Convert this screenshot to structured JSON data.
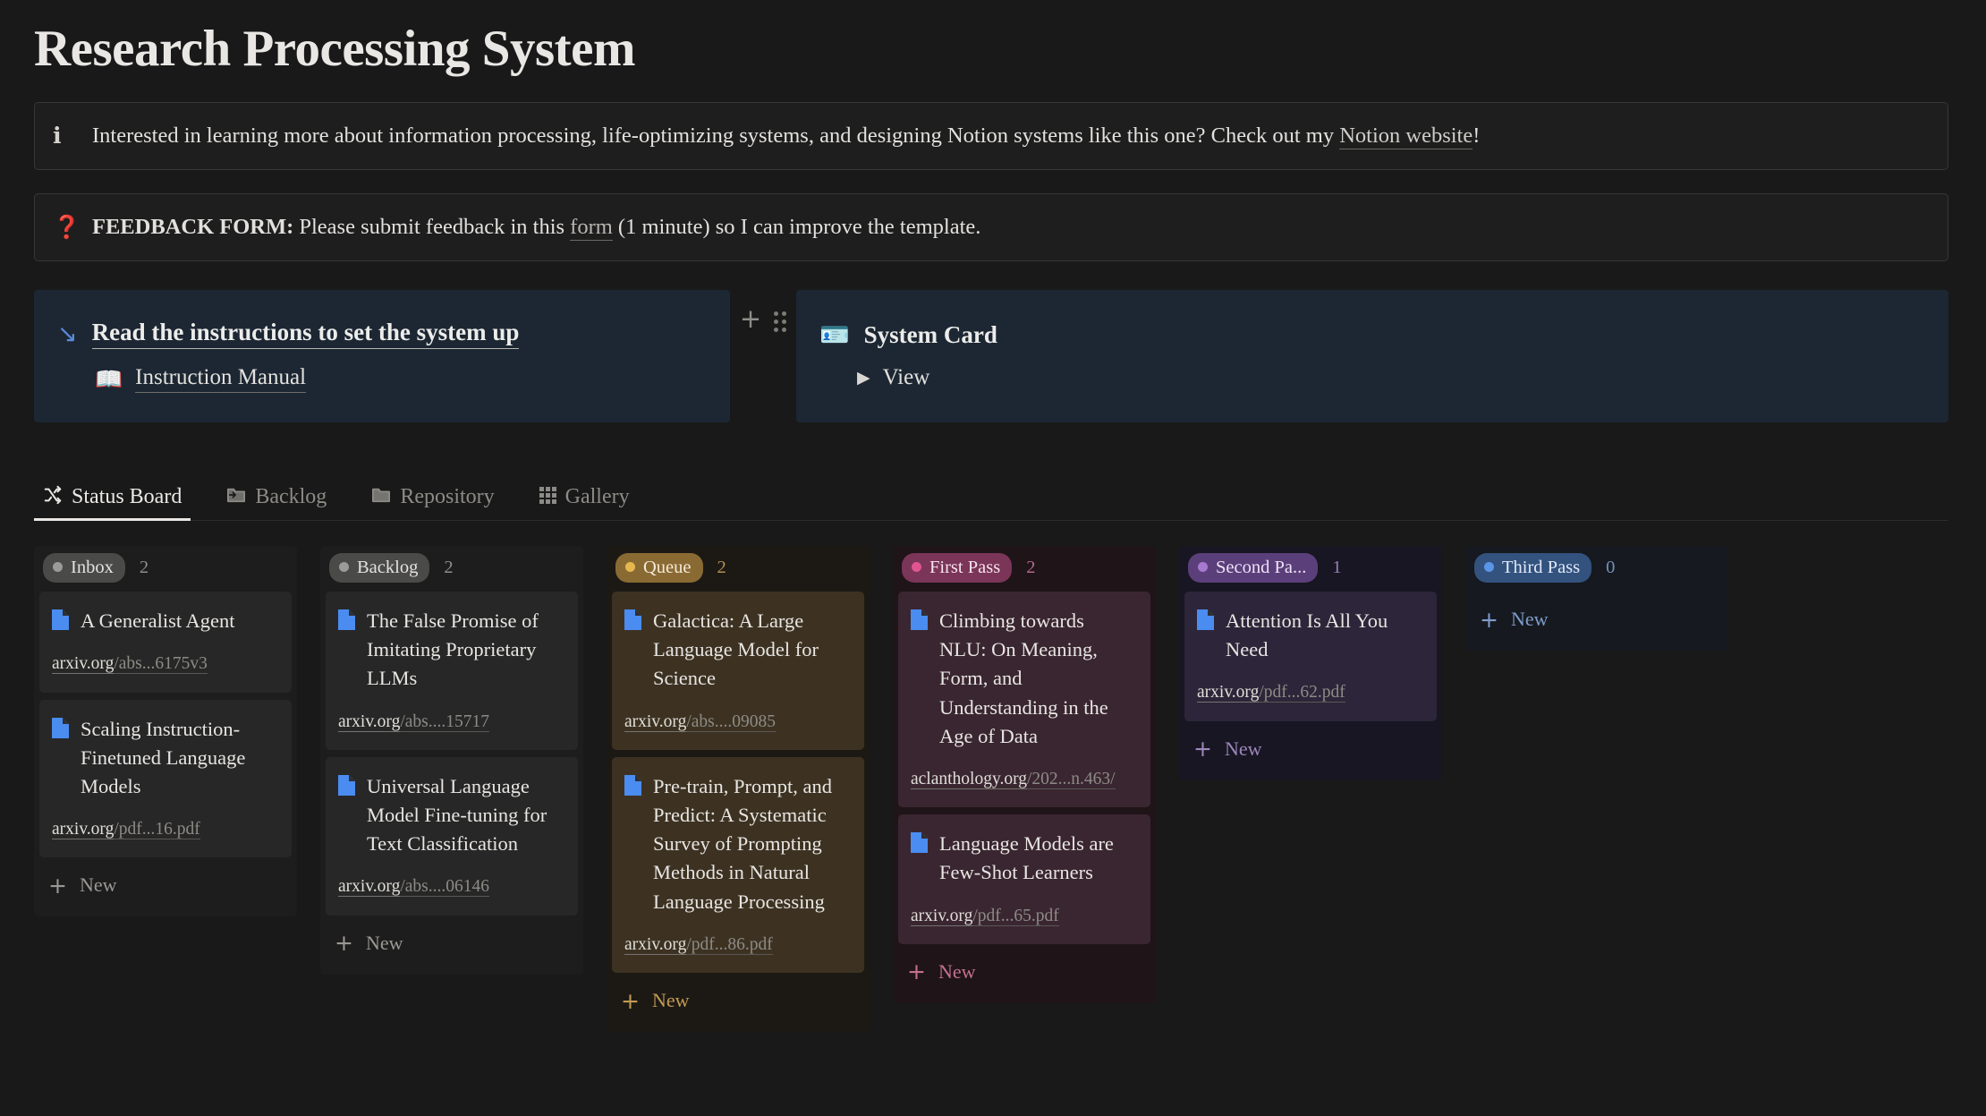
{
  "page": {
    "title": "Research Processing System"
  },
  "callouts": [
    {
      "icon": "info-icon",
      "glyph": "ℹ",
      "segments": [
        {
          "type": "text",
          "value": "Interested in learning more about information processing, life-optimizing systems, and designing Notion systems like this one? Check out my "
        },
        {
          "type": "link",
          "value": "Notion website"
        },
        {
          "type": "text",
          "value": "!"
        }
      ]
    },
    {
      "icon": "question-icon",
      "glyph": "❓",
      "segments": [
        {
          "type": "bold",
          "value": "FEEDBACK FORM:"
        },
        {
          "type": "text",
          "value": " Please submit feedback in this "
        },
        {
          "type": "link",
          "value": "form"
        },
        {
          "type": "text",
          "value": " (1 minute) so I can improve the template."
        }
      ]
    }
  ],
  "feature_cards": {
    "gutter": {
      "add_label": "+",
      "drag_label": "drag-handle"
    },
    "left": {
      "icon": "arrow-down-right-icon",
      "glyph": "↘",
      "title": "Read the instructions to set the system up",
      "sub_icon": "open-book-icon",
      "sub_glyph": "📖",
      "sub_label": "Instruction Manual"
    },
    "right": {
      "icon": "id-badge-icon",
      "glyph": "🪪",
      "title": "System Card",
      "toggle_glyph": "▶",
      "toggle_label": "View"
    }
  },
  "tabs": [
    {
      "label": "Status Board",
      "icon": "shuffle-icon",
      "glyph": "🔀",
      "active": true
    },
    {
      "label": "Backlog",
      "icon": "folder-in-icon",
      "glyph": "📂",
      "active": false
    },
    {
      "label": "Repository",
      "icon": "folder-icon",
      "glyph": "📁",
      "active": false
    },
    {
      "label": "Gallery",
      "icon": "grid-icon",
      "glyph": "▒",
      "active": false
    }
  ],
  "board": {
    "new_label": "New",
    "columns": [
      {
        "name": "Inbox",
        "count": "2",
        "colors": {
          "pill_bg": "#4a4a48",
          "pill_text": "#e4e2df",
          "dot": "#9b9b97",
          "col_bg": "#1d1d1d",
          "card_bg": "#272727",
          "count_text": "#8f8d89",
          "new_text": "#9a9894"
        },
        "cards": [
          {
            "title": "A Generalist Agent",
            "host": "arxiv.org",
            "path": "/abs...6175v3"
          },
          {
            "title": "Scaling Instruction-Finetuned Language Models",
            "host": "arxiv.org",
            "path": "/pdf...16.pdf"
          }
        ]
      },
      {
        "name": "Backlog",
        "count": "2",
        "colors": {
          "pill_bg": "#4a4a48",
          "pill_text": "#e4e2df",
          "dot": "#9b9b97",
          "col_bg": "#1d1d1d",
          "card_bg": "#272727",
          "count_text": "#8f8d89",
          "new_text": "#9a9894"
        },
        "cards": [
          {
            "title": "The False Promise of Imitating Proprietary LLMs",
            "host": "arxiv.org",
            "path": "/abs....15717"
          },
          {
            "title": "Universal Language Model Fine-tuning for Text Classification",
            "host": "arxiv.org",
            "path": "/abs....06146"
          }
        ]
      },
      {
        "name": "Queue",
        "count": "2",
        "colors": {
          "pill_bg": "#8a6a33",
          "pill_text": "#f4ead8",
          "dot": "#e5b84f",
          "col_bg": "#20191181",
          "card_bg": "#3d3222",
          "count_text": "#b18f4f",
          "new_text": "#c29a52"
        },
        "cards": [
          {
            "title": "Galactica: A Large Language Model for Science",
            "host": "arxiv.org",
            "path": "/abs....09085"
          },
          {
            "title": "Pre-train, Prompt, and Predict: A Systematic Survey of Prompting Methods in Natural Language Processing",
            "host": "arxiv.org",
            "path": "/pdf...86.pdf"
          }
        ]
      },
      {
        "name": "First Pass",
        "count": "2",
        "colors": {
          "pill_bg": "#7a3558",
          "pill_text": "#f6e3ec",
          "dot": "#e0558f",
          "col_bg": "#1f1418",
          "card_bg": "#3a2630",
          "count_text": "#b06a8c",
          "new_text": "#c4708f"
        },
        "cards": [
          {
            "title": "Climbing towards NLU: On Meaning, Form, and Understanding in the Age of Data",
            "host": "aclanthology.org",
            "path": "/202...n.463/"
          },
          {
            "title": "Language Models are Few-Shot Learners",
            "host": "arxiv.org",
            "path": "/pdf...65.pdf"
          }
        ]
      },
      {
        "name": "Second Pa...",
        "count": "1",
        "colors": {
          "pill_bg": "#5b3f7a",
          "pill_text": "#eee2f7",
          "dot": "#a77ad0",
          "col_bg": "#181622",
          "card_bg": "#2d2539",
          "count_text": "#9780b5",
          "new_text": "#9e86bd"
        },
        "cards": [
          {
            "title": "Attention Is All You Need",
            "host": "arxiv.org",
            "path": "/pdf...62.pdf"
          }
        ]
      },
      {
        "name": "Third Pass",
        "count": "0",
        "colors": {
          "pill_bg": "#33527e",
          "pill_text": "#dfe9f8",
          "dot": "#5b95e8",
          "col_bg": "#16191f",
          "card_bg": "#232c3a",
          "count_text": "#7590b8",
          "new_text": "#7f9ccb"
        },
        "cards": []
      }
    ]
  }
}
